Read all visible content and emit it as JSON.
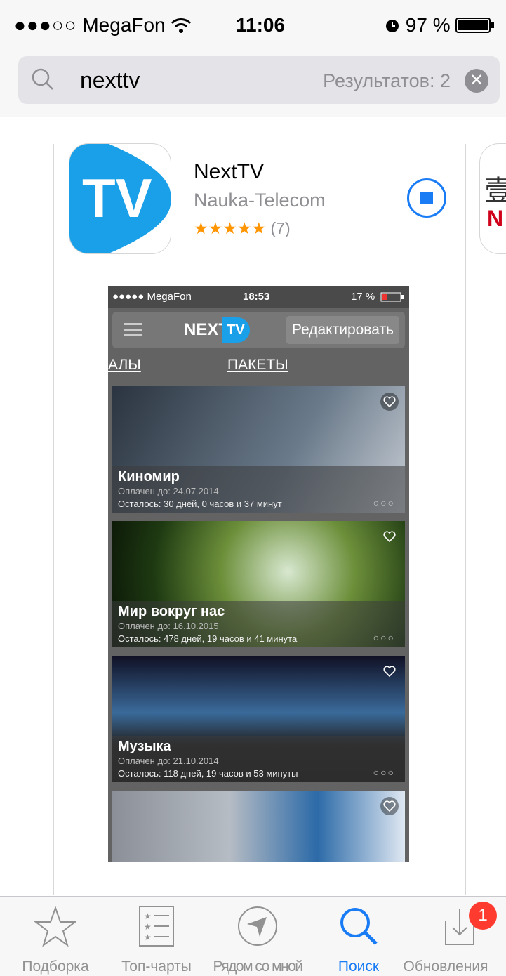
{
  "status_bar": {
    "signal": "●●●○○",
    "carrier": "MegaFon",
    "time": "11:06",
    "battery": "97 %"
  },
  "search": {
    "query": "nexttv",
    "results": "Результатов: 2"
  },
  "app": {
    "name": "NextTV",
    "developer": "Nauka-Telecom",
    "stars": "★★★★★",
    "rating_count": "(7)",
    "icon_text": "TV"
  },
  "next_app_icon": {
    "glyph": "壹",
    "letter": "N"
  },
  "screenshot": {
    "status": {
      "carrier": "●●●●● MegaFon",
      "time": "18:53",
      "battery": "17 %"
    },
    "logo": "NEXT",
    "logo_badge": "TV",
    "edit_label": "Редактировать",
    "tabs": [
      "АЛЫ",
      "ПАКЕТЫ"
    ],
    "channels": [
      {
        "title": "Киномир",
        "paid": "Оплачен до: 24.07.2014",
        "left": "Осталось: 30 дней, 0 часов и 37 минут",
        "more": "○○○",
        "bg": [
          "#2b3440",
          "#6a7a8a"
        ]
      },
      {
        "title": "Мир вокруг нас",
        "paid": "Оплачен до: 16.10.2015",
        "left": "Осталось: 478 дней, 19 часов и 41 минута",
        "more": "○○○",
        "bg": [
          "#1e3a12",
          "#6c8f3a"
        ]
      },
      {
        "title": "Музыка",
        "paid": "Оплачен до: 21.10.2014",
        "left": "Осталось: 118 дней, 19 часов и 53 минуты",
        "more": "○○○",
        "bg": [
          "#101024",
          "#3a6a9a"
        ]
      },
      {
        "title": "",
        "paid": "",
        "left": "",
        "more": "",
        "bg": [
          "#8a8f98",
          "#2c6aa8"
        ]
      }
    ]
  },
  "tabbar": [
    {
      "label": "Подборка",
      "icon": "star-icon"
    },
    {
      "label": "Топ-чарты",
      "icon": "list-icon"
    },
    {
      "label": "Рядом со мной",
      "icon": "location-icon"
    },
    {
      "label": "Поиск",
      "icon": "search-icon",
      "active": true
    },
    {
      "label": "Обновления",
      "icon": "updates-icon",
      "badge": "1"
    }
  ],
  "colors": {
    "accent": "#1a7cf5",
    "star": "#ff9500",
    "badge": "#ff3b30",
    "tv_blue": "#1aa0e8"
  }
}
